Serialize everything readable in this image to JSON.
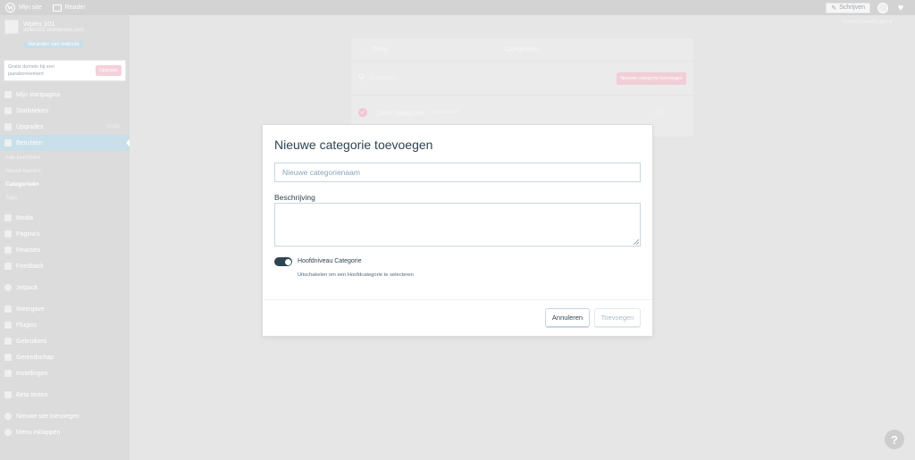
{
  "masterbar": {
    "my_site": "Mijn site",
    "reader": "Reader",
    "write": "Schrijven"
  },
  "site": {
    "title": "Wplex 101",
    "domain": "wplex101.wordpress.com",
    "switch_label": "Verander van website"
  },
  "domain_nudge": {
    "text": "Gratis domein bij een jaarabonnement",
    "button": "Upgrade"
  },
  "sidebar": {
    "items": [
      {
        "label": "Mijn startpagina",
        "icon": "home-icon"
      },
      {
        "label": "Statistieken",
        "icon": "stats-icon"
      },
      {
        "label": "Upgrades",
        "icon": "cart-icon",
        "badge": "Gratis"
      },
      {
        "label": "Berichten",
        "icon": "pin-icon"
      }
    ],
    "posts_sub": [
      "Alle berichten",
      "Nieuw bericht",
      "Categorieën",
      "Tags"
    ],
    "items2": [
      {
        "label": "Media",
        "icon": "media-icon"
      },
      {
        "label": "Pagina's",
        "icon": "pages-icon"
      },
      {
        "label": "Reacties",
        "icon": "comments-icon"
      },
      {
        "label": "Feedback",
        "icon": "feedback-icon"
      }
    ],
    "jetpack": "Jetpack",
    "items3": [
      {
        "label": "Weergave",
        "icon": "appearance-icon"
      },
      {
        "label": "Plugins",
        "icon": "plugins-icon"
      },
      {
        "label": "Gebruikers",
        "icon": "users-icon"
      },
      {
        "label": "Gereedschap",
        "icon": "tools-icon"
      },
      {
        "label": "Instellingen",
        "icon": "settings-icon"
      }
    ],
    "beta": "Bèta testen",
    "add_site": "Nieuwe site toevoegen",
    "manage_menu": "Menu inklappen"
  },
  "screen_options": "Scherminstellingen ▾",
  "categories": {
    "back": "Terug",
    "title": "Categorieën",
    "search_placeholder": "Zoeken...",
    "add_button": "Nieuwe categorie toevoegen",
    "row_name": "Geen categorie",
    "row_badge": "STANDAARD"
  },
  "modal": {
    "title": "Nieuwe categorie toevoegen",
    "name_placeholder": "Nieuwe categorienaam",
    "description_label": "Beschrijving",
    "toggle_label": "Hoofdniveau Categorie",
    "toggle_help": "Uitschakelen om een Hoofdcategorie te selecteren",
    "toggle_on": true,
    "cancel": "Annuleren",
    "add": "Toevoegen"
  },
  "help_label": "?"
}
